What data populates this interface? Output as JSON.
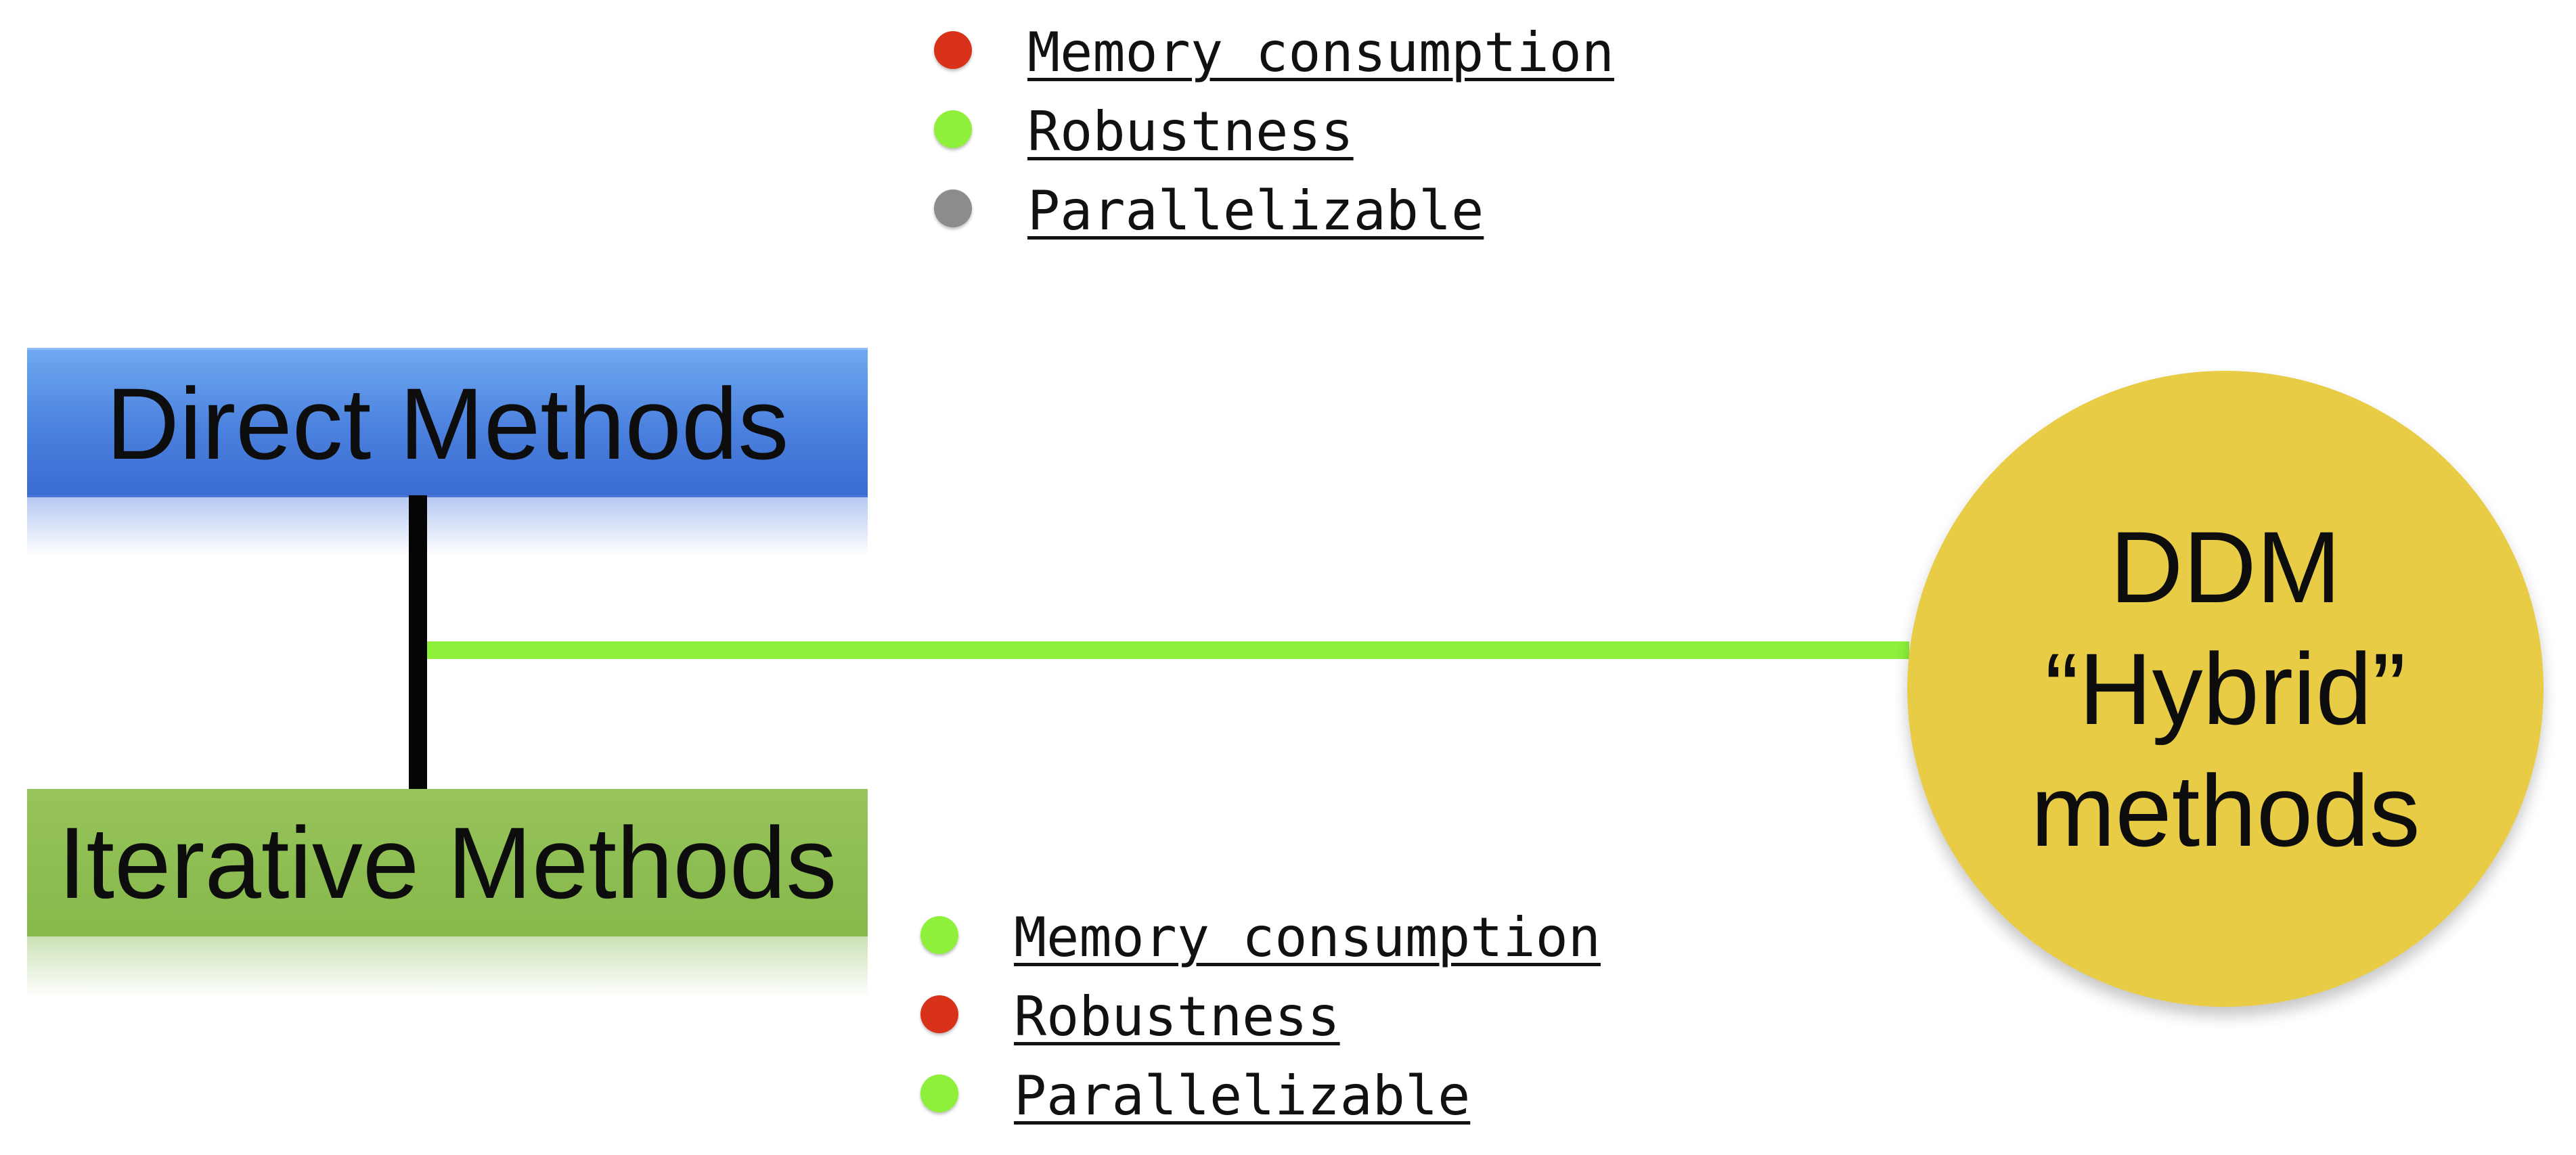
{
  "direct_properties": [
    {
      "label": "Memory consumption",
      "status_color": "#d8331a",
      "icon": "red-dot"
    },
    {
      "label": "Robustness",
      "status_color": "#8ef03a",
      "icon": "green-dot"
    },
    {
      "label": "Parallelizable",
      "status_color": "#8c8c8c",
      "icon": "gray-dot"
    }
  ],
  "direct_methods": {
    "label": "Direct Methods",
    "color": "#4a80de"
  },
  "iterative_methods": {
    "label": "Iterative Methods",
    "color": "#86b84a"
  },
  "iterative_properties": [
    {
      "label": "Memory consumption",
      "status_color": "#8ef03a",
      "icon": "green-dot"
    },
    {
      "label": "Robustness",
      "status_color": "#d8331a",
      "icon": "red-dot"
    },
    {
      "label": "Parallelizable",
      "status_color": "#8ef03a",
      "icon": "green-dot"
    }
  ],
  "hybrid": {
    "line1": "DDM",
    "line2": "“Hybrid”",
    "line3": "methods",
    "color": "#e8cc45"
  },
  "connectors": {
    "vertical_color": "#050505",
    "horizontal_color": "#8ef03a"
  }
}
